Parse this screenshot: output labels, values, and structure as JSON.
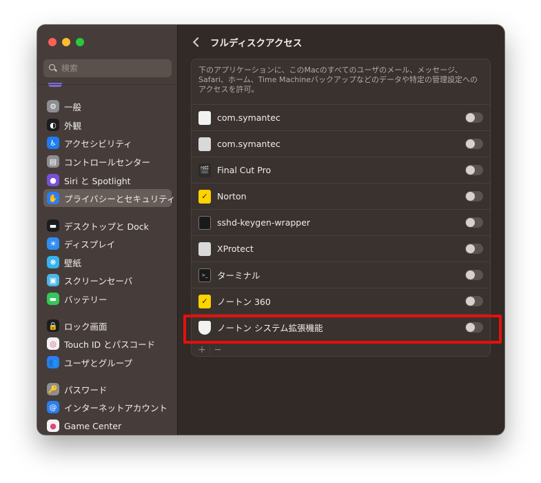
{
  "sidebar": {
    "search_placeholder": "検索",
    "items": [
      {
        "label": "一般",
        "icon": "gear-icon",
        "color": "#8e8e93"
      },
      {
        "label": "外観",
        "icon": "appearance-icon",
        "color": "#1c1c1e"
      },
      {
        "label": "アクセシビリティ",
        "icon": "accessibility-icon",
        "color": "#1f7cf2"
      },
      {
        "label": "コントロールセンター",
        "icon": "control-center-icon",
        "color": "#8e8e93"
      },
      {
        "label": "Siri と Spotlight",
        "icon": "siri-icon",
        "color": "#7b4fd6"
      },
      {
        "label": "プライバシーとセキュリティ",
        "icon": "privacy-hand-icon",
        "color": "#2c7df0",
        "selected": true
      },
      {
        "label": "デスクトップと Dock",
        "icon": "dock-icon",
        "color": "#1c1c1e"
      },
      {
        "label": "ディスプレイ",
        "icon": "display-icon",
        "color": "#2f8df5"
      },
      {
        "label": "壁紙",
        "icon": "wallpaper-icon",
        "color": "#35b3f0"
      },
      {
        "label": "スクリーンセーバ",
        "icon": "screensaver-icon",
        "color": "#4bb6e8"
      },
      {
        "label": "バッテリー",
        "icon": "battery-icon",
        "color": "#34c759"
      },
      {
        "label": "ロック画面",
        "icon": "lock-icon",
        "color": "#1c1c1e"
      },
      {
        "label": "Touch ID とパスコード",
        "icon": "fingerprint-icon",
        "color": "#f2f2f2"
      },
      {
        "label": "ユーザとグループ",
        "icon": "users-icon",
        "color": "#2c7df0"
      },
      {
        "label": "パスワード",
        "icon": "key-icon",
        "color": "#8e8e93"
      },
      {
        "label": "インターネットアカウント",
        "icon": "at-icon",
        "color": "#2c7df0"
      },
      {
        "label": "Game Center",
        "icon": "game-center-icon",
        "color": "#f2f2f2"
      }
    ]
  },
  "main": {
    "title": "フルディスクアクセス",
    "description": "下のアプリケーションに、このMacのすべてのユーザのメール、メッセージ、Safari、ホーム、Time Machineバックアップなどのデータや特定の管理設定へのアクセスを許可。",
    "apps": [
      {
        "name": "com.symantec",
        "icon": "document-icon",
        "enabled": false
      },
      {
        "name": "com.symantec",
        "icon": "generic-app-icon",
        "enabled": false
      },
      {
        "name": "Final Cut Pro",
        "icon": "final-cut-pro-icon",
        "enabled": false
      },
      {
        "name": "Norton",
        "icon": "norton-icon",
        "enabled": false
      },
      {
        "name": "sshd-keygen-wrapper",
        "icon": "terminal-exec-icon",
        "enabled": false
      },
      {
        "name": "XProtect",
        "icon": "generic-app-icon",
        "enabled": false
      },
      {
        "name": "ターミナル",
        "icon": "terminal-icon",
        "enabled": false
      },
      {
        "name": "ノートン 360",
        "icon": "norton-icon",
        "enabled": false
      },
      {
        "name": "ノートン システム拡張機能",
        "icon": "shield-icon",
        "enabled": false
      }
    ],
    "footer": {
      "add": "+",
      "remove": "−"
    }
  },
  "colors": {
    "highlight": "#e5100c",
    "sidebar_bg": "#463d3a",
    "main_bg": "#322a27"
  }
}
